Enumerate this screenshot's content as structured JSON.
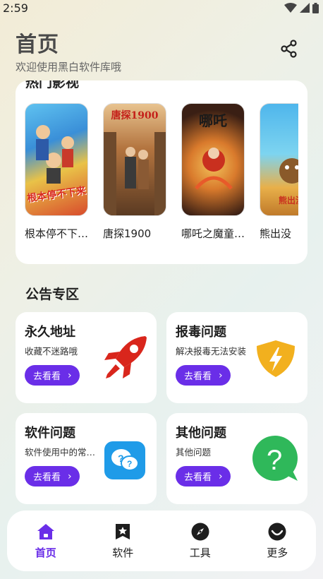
{
  "status_bar": {
    "time": "2:59"
  },
  "header": {
    "title": "首页",
    "subtitle": "欢迎使用黑白软件库哦"
  },
  "movies": {
    "section_title": "热门影视",
    "items": [
      {
        "name": "根本停不下…",
        "poster_text": "根本停不下来"
      },
      {
        "name": "唐探1900",
        "poster_text": "唐探1900"
      },
      {
        "name": "哪吒之魔童…",
        "poster_text": "哪吒"
      },
      {
        "name": "熊出没",
        "poster_text": "熊出没"
      }
    ]
  },
  "notices": {
    "section_title": "公告专区",
    "button_label": "去看看",
    "cards": [
      {
        "title": "永久地址",
        "desc": "收藏不迷路哦",
        "icon": "rocket-icon"
      },
      {
        "title": "报毒问题",
        "desc": "解决报毒无法安装",
        "icon": "shield-lightning-icon"
      },
      {
        "title": "软件问题",
        "desc": "软件使用中的常…",
        "icon": "chat-question-icon"
      },
      {
        "title": "其他问题",
        "desc": "其他问题",
        "icon": "question-bubble-icon"
      }
    ]
  },
  "nav": {
    "items": [
      {
        "label": "首页",
        "icon": "home-icon",
        "active": true
      },
      {
        "label": "软件",
        "icon": "star-bookmark-icon",
        "active": false
      },
      {
        "label": "工具",
        "icon": "compass-icon",
        "active": false
      },
      {
        "label": "更多",
        "icon": "smile-icon",
        "active": false
      }
    ]
  },
  "colors": {
    "accent": "#6a2ee8",
    "rocket": "#d9261c",
    "shield": "#f2b01e",
    "chat": "#1f9be8",
    "question": "#2fb85a"
  }
}
